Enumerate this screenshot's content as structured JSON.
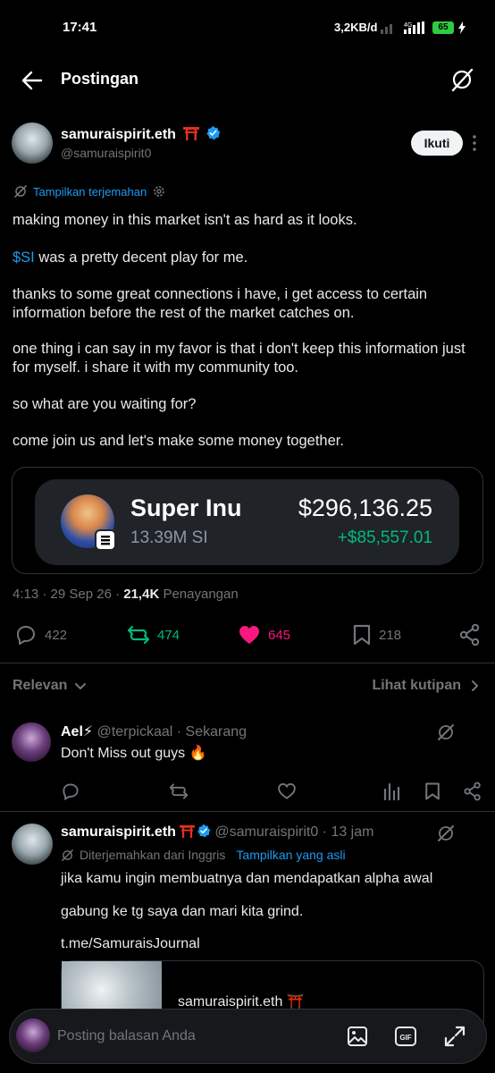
{
  "status_bar": {
    "time": "17:41",
    "net_speed": "3,2KB/d",
    "network": "4G",
    "battery": "65"
  },
  "header": {
    "title": "Postingan"
  },
  "post": {
    "author": {
      "name": "samuraispirit.eth",
      "handle": "@samuraispirit0",
      "verified": true
    },
    "follow_label": "Ikuti",
    "translate_label": "Tampilkan terjemahan",
    "paragraphs": {
      "p1": "making money in this market isn't as hard as it looks.",
      "p2_ticker": "$SI",
      "p2_rest": " was a pretty decent play for me.",
      "p3": "thanks to some great connections i have, i get access to certain information before the rest of the market catches on.",
      "p4": "one thing i can say in my favor is that i don't keep this information just for myself. i share it with my community too.",
      "p5": "so what are you waiting for?",
      "p6": "come join us and let's make some money together."
    },
    "card": {
      "coin_name": "Super Inu",
      "coin_amount": "13.39M SI",
      "value": "$296,136.25",
      "gain": "+$85,557.01"
    },
    "meta": {
      "time": "4:13 · 29 Sep 26 · ",
      "views": "21,4K",
      "views_label": " Penayangan"
    },
    "stats": {
      "replies": "422",
      "reposts": "474",
      "likes": "645",
      "bookmarks": "218"
    },
    "colors": {
      "repost": "#00ba7c",
      "like": "#f91880",
      "link": "#1d9bf0"
    }
  },
  "replies_bar": {
    "sort_label": "Relevan",
    "quotes_label": "Lihat kutipan"
  },
  "replies": [
    {
      "name": "Ael⚡",
      "handle": "@terpickaal · Sekarang",
      "text": "Don't Miss out guys 🔥"
    },
    {
      "name": "samuraispirit.eth",
      "handle": "@samuraispirit0 · 13 jam",
      "translated_from": "Diterjemahkan dari Inggris",
      "show_original": "Tampilkan yang asli",
      "text1": "jika kamu ingin membuatnya dan mendapatkan alpha awal",
      "text2": "gabung ke tg saya dan mari kita grind.",
      "link": "t.me/SamuraisJournal",
      "preview_title": "samuraispirit.eth ⛩️"
    }
  ],
  "composer": {
    "placeholder": "Posting balasan Anda"
  }
}
